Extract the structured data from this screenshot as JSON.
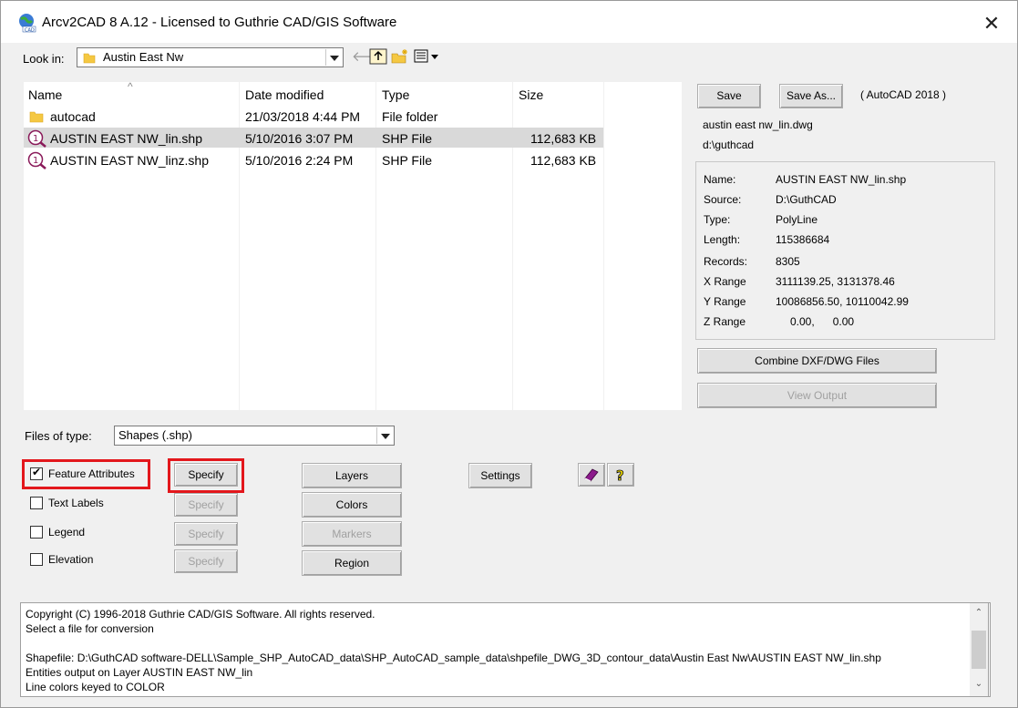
{
  "window": {
    "title": "Arcv2CAD 8 A.12 - Licensed to Guthrie CAD/GIS Software"
  },
  "look_in": {
    "label": "Look in:",
    "value": "Austin East Nw"
  },
  "columns": {
    "name": "Name",
    "date": "Date modified",
    "type": "Type",
    "size": "Size"
  },
  "files": [
    {
      "name": "autocad",
      "date": "21/03/2018 4:44 PM",
      "type": "File folder",
      "size": "",
      "icon": "folder-icon",
      "selected": false
    },
    {
      "name": "AUSTIN EAST NW_lin.shp",
      "date": "5/10/2016 3:07 PM",
      "type": "SHP File",
      "size": "112,683 KB",
      "icon": "shapefile-icon",
      "selected": true
    },
    {
      "name": "AUSTIN EAST NW_linz.shp",
      "date": "5/10/2016 2:24 PM",
      "type": "SHP File",
      "size": "112,683 KB",
      "icon": "shapefile-icon",
      "selected": false
    }
  ],
  "files_of_type": {
    "label": "Files of type:",
    "value": "Shapes (.shp)"
  },
  "right": {
    "save": "Save",
    "save_as": "Save As...",
    "format": "( AutoCAD 2018 )",
    "out_file": "austin east nw_lin.dwg",
    "out_dir": "d:\\guthcad",
    "combine": "Combine DXF/DWG Files",
    "view_output": "View Output"
  },
  "info": {
    "name_label": "Name:",
    "name": "AUSTIN EAST NW_lin.shp",
    "source_label": "Source:",
    "source": "D:\\GuthCAD",
    "type_label": "Type:",
    "type": "PolyLine",
    "length_label": "Length:",
    "length": "115386684",
    "records_label": "Records:",
    "records": "8305",
    "xrange_label": "X Range",
    "xrange": "3111139.25, 3131378.46",
    "yrange_label": "Y Range",
    "yrange": "10086856.50, 10110042.99",
    "zrange_label": "Z Range",
    "zrange": "0.00,      0.00"
  },
  "options": {
    "feature_attributes": "Feature Attributes",
    "text_labels": "Text Labels",
    "legend": "Legend",
    "elevation": "Elevation",
    "specify": "Specify"
  },
  "buttons": {
    "layers": "Layers",
    "colors": "Colors",
    "markers": "Markers",
    "region": "Region",
    "settings": "Settings"
  },
  "log": [
    "Copyright (C) 1996-2018 Guthrie CAD/GIS Software.  All rights reserved.",
    "Select a file for conversion",
    "",
    "Shapefile: D:\\GuthCAD software-DELL\\Sample_SHP_AutoCAD_data\\SHP_AutoCAD_sample_data\\shpefile_DWG_3D_contour_data\\Austin East Nw\\AUSTIN EAST NW_lin.shp",
    "Entities output on Layer AUSTIN EAST NW_lin",
    "Line colors keyed to COLOR"
  ],
  "colors": {
    "highlight": "#e3171c",
    "selection": "#d9d9d9"
  }
}
